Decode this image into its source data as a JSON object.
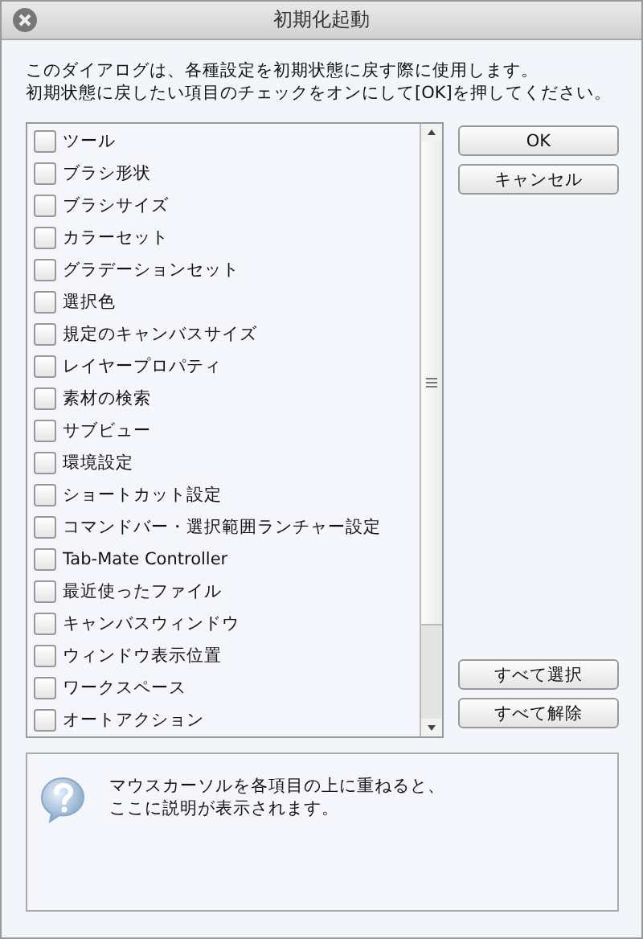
{
  "window": {
    "title": "初期化起動"
  },
  "intro": [
    "このダイアログは、各種設定を初期状態に戻す際に使用します。",
    "初期状態に戻したい項目のチェックをオンにして[OK]を押してください。"
  ],
  "items": [
    {
      "label": "ツール",
      "checked": false
    },
    {
      "label": "ブラシ形状",
      "checked": false
    },
    {
      "label": "ブラシサイズ",
      "checked": false
    },
    {
      "label": "カラーセット",
      "checked": false
    },
    {
      "label": "グラデーションセット",
      "checked": false
    },
    {
      "label": "選択色",
      "checked": false
    },
    {
      "label": "規定のキャンバスサイズ",
      "checked": false
    },
    {
      "label": "レイヤープロパティ",
      "checked": false
    },
    {
      "label": "素材の検索",
      "checked": false
    },
    {
      "label": "サブビュー",
      "checked": false
    },
    {
      "label": "環境設定",
      "checked": false
    },
    {
      "label": "ショートカット設定",
      "checked": false
    },
    {
      "label": "コマンドバー・選択範囲ランチャー設定",
      "checked": false
    },
    {
      "label": "Tab-Mate Controller",
      "checked": false
    },
    {
      "label": "最近使ったファイル",
      "checked": false
    },
    {
      "label": "キャンバスウィンドウ",
      "checked": false
    },
    {
      "label": "ウィンドウ表示位置",
      "checked": false
    },
    {
      "label": "ワークスペース",
      "checked": false
    },
    {
      "label": "オートアクション",
      "checked": false
    }
  ],
  "top_buttons": [
    "OK",
    "キャンセル"
  ],
  "bottom_buttons": [
    "すべて選択",
    "すべて解除"
  ],
  "help": [
    "マウスカーソルを各項目の上に重ねると、",
    "ここに説明が表示されます。"
  ]
}
